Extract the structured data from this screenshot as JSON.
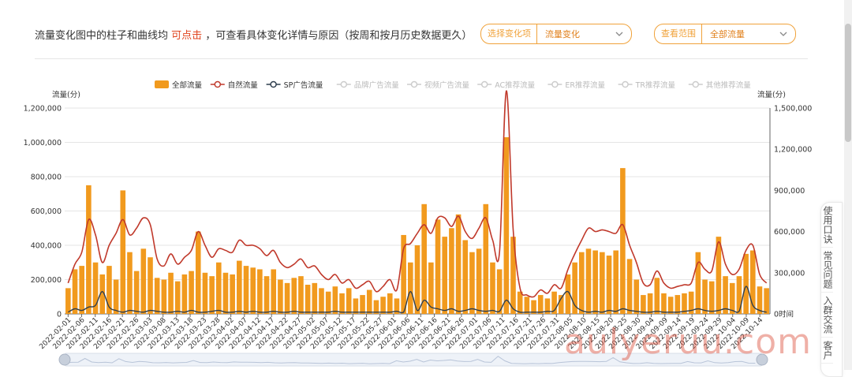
{
  "header": {
    "text_before": "流量变化图中的柱子和曲线均",
    "link_text": "可点击",
    "text_after": "，可查看具体变化详情与原因（按周和按月历史数据更久）"
  },
  "selectors": [
    {
      "label": "选择变化项",
      "value": "流量变化"
    },
    {
      "label": "查看范围",
      "value": "全部流量"
    }
  ],
  "side_tools": [
    "使用口诀",
    "常见问题",
    "入群交流",
    "客户"
  ],
  "watermark": "aulyeruu.com",
  "colors": {
    "bar": "#f19a1e",
    "natural": "#c0392b",
    "sp": "#2f3e4e",
    "disabled": "#cccccc",
    "accent": "#f0a23a"
  },
  "chart_data": {
    "type": "bar",
    "legend": [
      {
        "name": "全部流量",
        "kind": "bar",
        "active": true
      },
      {
        "name": "自然流量",
        "kind": "line",
        "active": true
      },
      {
        "name": "SP广告流量",
        "kind": "line",
        "active": true
      },
      {
        "name": "品牌广告流量",
        "kind": "line",
        "active": false
      },
      {
        "name": "视频广告流量",
        "kind": "line",
        "active": false
      },
      {
        "name": "AC推荐流量",
        "kind": "line",
        "active": false
      },
      {
        "name": "ER推荐流量",
        "kind": "line",
        "active": false
      },
      {
        "name": "TR推荐流量",
        "kind": "line",
        "active": false
      },
      {
        "name": "其他推荐流量",
        "kind": "line",
        "active": false
      }
    ],
    "ylabel_left": "流量(分)",
    "ylabel_right": "流量(分)",
    "x_axis_name": "时间",
    "y_left_ticks": [
      "0",
      "200,000",
      "400,000",
      "600,000",
      "800,000",
      "1,000,000",
      "1,200,000"
    ],
    "y_right_ticks": [
      "0",
      "300,000",
      "600,000",
      "900,000",
      "1,200,000",
      "1,500,000"
    ],
    "ylim_left": [
      0,
      1200000
    ],
    "ylim_right": [
      0,
      1500000
    ],
    "x_tick_labels": [
      "2022-02-01",
      "2022-02-06",
      "2022-02-11",
      "2022-02-16",
      "2022-02-21",
      "2022-02-26",
      "2022-03-03",
      "2022-03-08",
      "2022-03-13",
      "2022-03-18",
      "2022-03-23",
      "2022-03-28",
      "2022-04-02",
      "2022-04-07",
      "2022-04-12",
      "2022-04-17",
      "2022-04-22",
      "2022-04-27",
      "2022-05-02",
      "2022-05-07",
      "2022-05-12",
      "2022-05-17",
      "2022-05-22",
      "2022-05-27",
      "2022-06-01",
      "2022-06-06",
      "2022-06-11",
      "2022-06-16",
      "2022-06-21",
      "2022-06-26",
      "2022-07-01",
      "2022-07-06",
      "2022-07-11",
      "2022-07-16",
      "2022-07-21",
      "2022-07-26",
      "2022-07-31",
      "2022-08-05",
      "2022-08-10",
      "2022-08-15",
      "2022-08-20",
      "2022-08-25",
      "2022-08-30",
      "2022-09-04",
      "2022-09-09",
      "2022-09-14",
      "2022-09-19",
      "2022-09-24",
      "2022-09-29",
      "2022-10-04",
      "2022-10-09",
      "2022-10-14"
    ],
    "bars_all": [
      150000,
      260000,
      280000,
      750000,
      300000,
      230000,
      280000,
      200000,
      720000,
      360000,
      250000,
      380000,
      330000,
      210000,
      200000,
      240000,
      190000,
      230000,
      250000,
      480000,
      240000,
      220000,
      300000,
      240000,
      230000,
      310000,
      280000,
      270000,
      260000,
      220000,
      260000,
      200000,
      180000,
      210000,
      220000,
      170000,
      180000,
      150000,
      130000,
      160000,
      120000,
      150000,
      90000,
      110000,
      140000,
      80000,
      100000,
      120000,
      90000,
      460000,
      300000,
      400000,
      640000,
      300000,
      550000,
      450000,
      500000,
      580000,
      430000,
      360000,
      380000,
      640000,
      300000,
      260000,
      1030000,
      450000,
      130000,
      100000,
      80000,
      110000,
      90000,
      130000,
      110000,
      230000,
      300000,
      360000,
      380000,
      370000,
      360000,
      340000,
      370000,
      850000,
      320000,
      200000,
      110000,
      120000,
      210000,
      120000,
      100000,
      110000,
      120000,
      130000,
      360000,
      200000,
      190000,
      450000,
      220000,
      180000,
      220000,
      350000,
      370000,
      160000,
      150000
    ],
    "natural": [
      180000,
      290000,
      360000,
      550000,
      460000,
      300000,
      400000,
      470000,
      550000,
      460000,
      500000,
      560000,
      520000,
      320000,
      280000,
      350000,
      290000,
      330000,
      370000,
      480000,
      400000,
      330000,
      380000,
      370000,
      360000,
      430000,
      400000,
      400000,
      380000,
      340000,
      370000,
      300000,
      270000,
      290000,
      320000,
      270000,
      280000,
      230000,
      200000,
      230000,
      180000,
      200000,
      150000,
      170000,
      190000,
      130000,
      160000,
      200000,
      140000,
      380000,
      410000,
      470000,
      520000,
      470000,
      560000,
      560000,
      510000,
      570000,
      480000,
      440000,
      500000,
      560000,
      430000,
      360000,
      1300000,
      490000,
      150000,
      110000,
      100000,
      140000,
      120000,
      170000,
      150000,
      260000,
      350000,
      430000,
      500000,
      480000,
      490000,
      480000,
      470000,
      520000,
      400000,
      300000,
      180000,
      170000,
      250000,
      180000,
      150000,
      160000,
      170000,
      180000,
      300000,
      260000,
      250000,
      420000,
      290000,
      230000,
      260000,
      370000,
      400000,
      230000,
      180000
    ],
    "sp": [
      10000,
      30000,
      20000,
      40000,
      50000,
      130000,
      40000,
      20000,
      10000,
      20000,
      15000,
      10000,
      20000,
      15000,
      10000,
      10000,
      15000,
      10000,
      20000,
      10000,
      10000,
      15000,
      20000,
      10000,
      10000,
      15000,
      10000,
      15000,
      10000,
      10000,
      15000,
      10000,
      10000,
      15000,
      10000,
      10000,
      10000,
      10000,
      10000,
      15000,
      10000,
      10000,
      10000,
      10000,
      10000,
      10000,
      10000,
      10000,
      15000,
      10000,
      130000,
      20000,
      80000,
      40000,
      30000,
      20000,
      30000,
      15000,
      20000,
      30000,
      20000,
      15000,
      20000,
      15000,
      80000,
      30000,
      10000,
      10000,
      10000,
      10000,
      15000,
      20000,
      90000,
      130000,
      50000,
      20000,
      10000,
      15000,
      10000,
      20000,
      15000,
      30000,
      20000,
      15000,
      10000,
      10000,
      15000,
      10000,
      10000,
      10000,
      15000,
      20000,
      30000,
      20000,
      15000,
      20000,
      30000,
      20000,
      15000,
      160000,
      50000,
      20000,
      10000
    ]
  }
}
